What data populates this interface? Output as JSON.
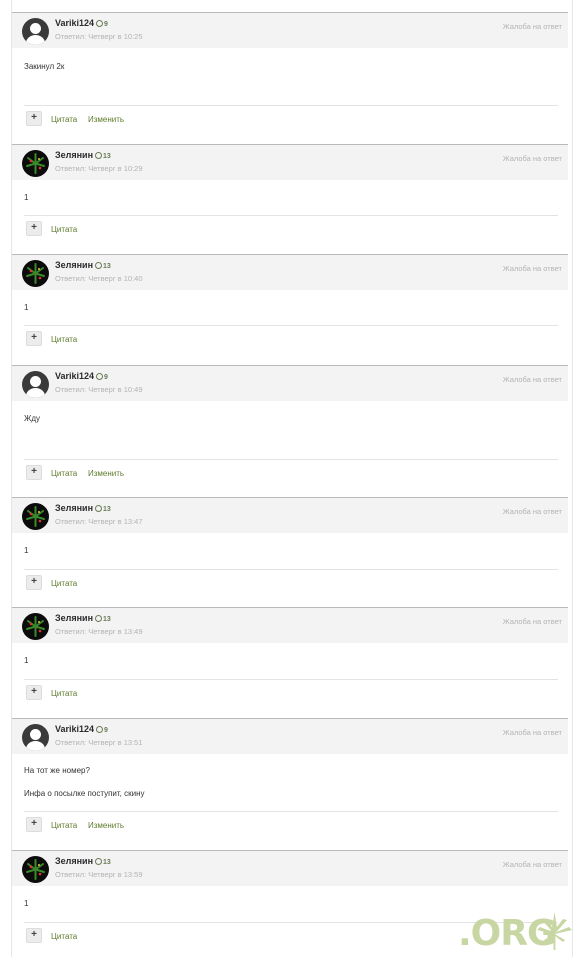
{
  "labels": {
    "report": "Жалоба на ответ",
    "quote": "Цитата",
    "edit": "Изменить",
    "plus": "+"
  },
  "posts": [
    {
      "author": "Variki124",
      "rep": "9",
      "meta": "Ответил: Четверг в 10:25",
      "lines": [
        "Закинул 2к"
      ],
      "avatar": "default-avatar",
      "editable": true
    },
    {
      "author": "Зелянин",
      "rep": "13",
      "meta": "Ответил: Четверг в 10:29",
      "lines": [
        "1"
      ],
      "avatar": "plant-avatar",
      "editable": false
    },
    {
      "author": "Зелянин",
      "rep": "13",
      "meta": "Ответил: Четверг в 10:40",
      "lines": [
        "1"
      ],
      "avatar": "plant-avatar",
      "editable": false
    },
    {
      "author": "Variki124",
      "rep": "9",
      "meta": "Ответил: Четверг в 10:49",
      "lines": [
        "Жду"
      ],
      "avatar": "default-avatar",
      "editable": true
    },
    {
      "author": "Зелянин",
      "rep": "13",
      "meta": "Ответил: Четверг в 13:47",
      "lines": [
        "1"
      ],
      "avatar": "plant-avatar",
      "editable": false
    },
    {
      "author": "Зелянин",
      "rep": "13",
      "meta": "Ответил: Четверг в 13:49",
      "lines": [
        "1"
      ],
      "avatar": "plant-avatar",
      "editable": false
    },
    {
      "author": "Variki124",
      "rep": "9",
      "meta": "Ответил: Четверг в 13:51",
      "lines": [
        "На тот же номер?",
        "Инфа о посылке поступит, скину"
      ],
      "avatar": "default-avatar",
      "editable": true
    },
    {
      "author": "Зелянин",
      "rep": "13",
      "meta": "Ответил: Четверг в 13:59",
      "lines": [
        "1"
      ],
      "avatar": "plant-avatar",
      "editable": false
    }
  ],
  "watermark": {
    "text": ".ORG",
    "icon": "cannabis-leaf-icon"
  },
  "colors": {
    "accent": "#5e7a2a",
    "header_bg": "#f3f3f3",
    "meta": "#b3b3b3",
    "watermark": "#c8d6a3"
  }
}
